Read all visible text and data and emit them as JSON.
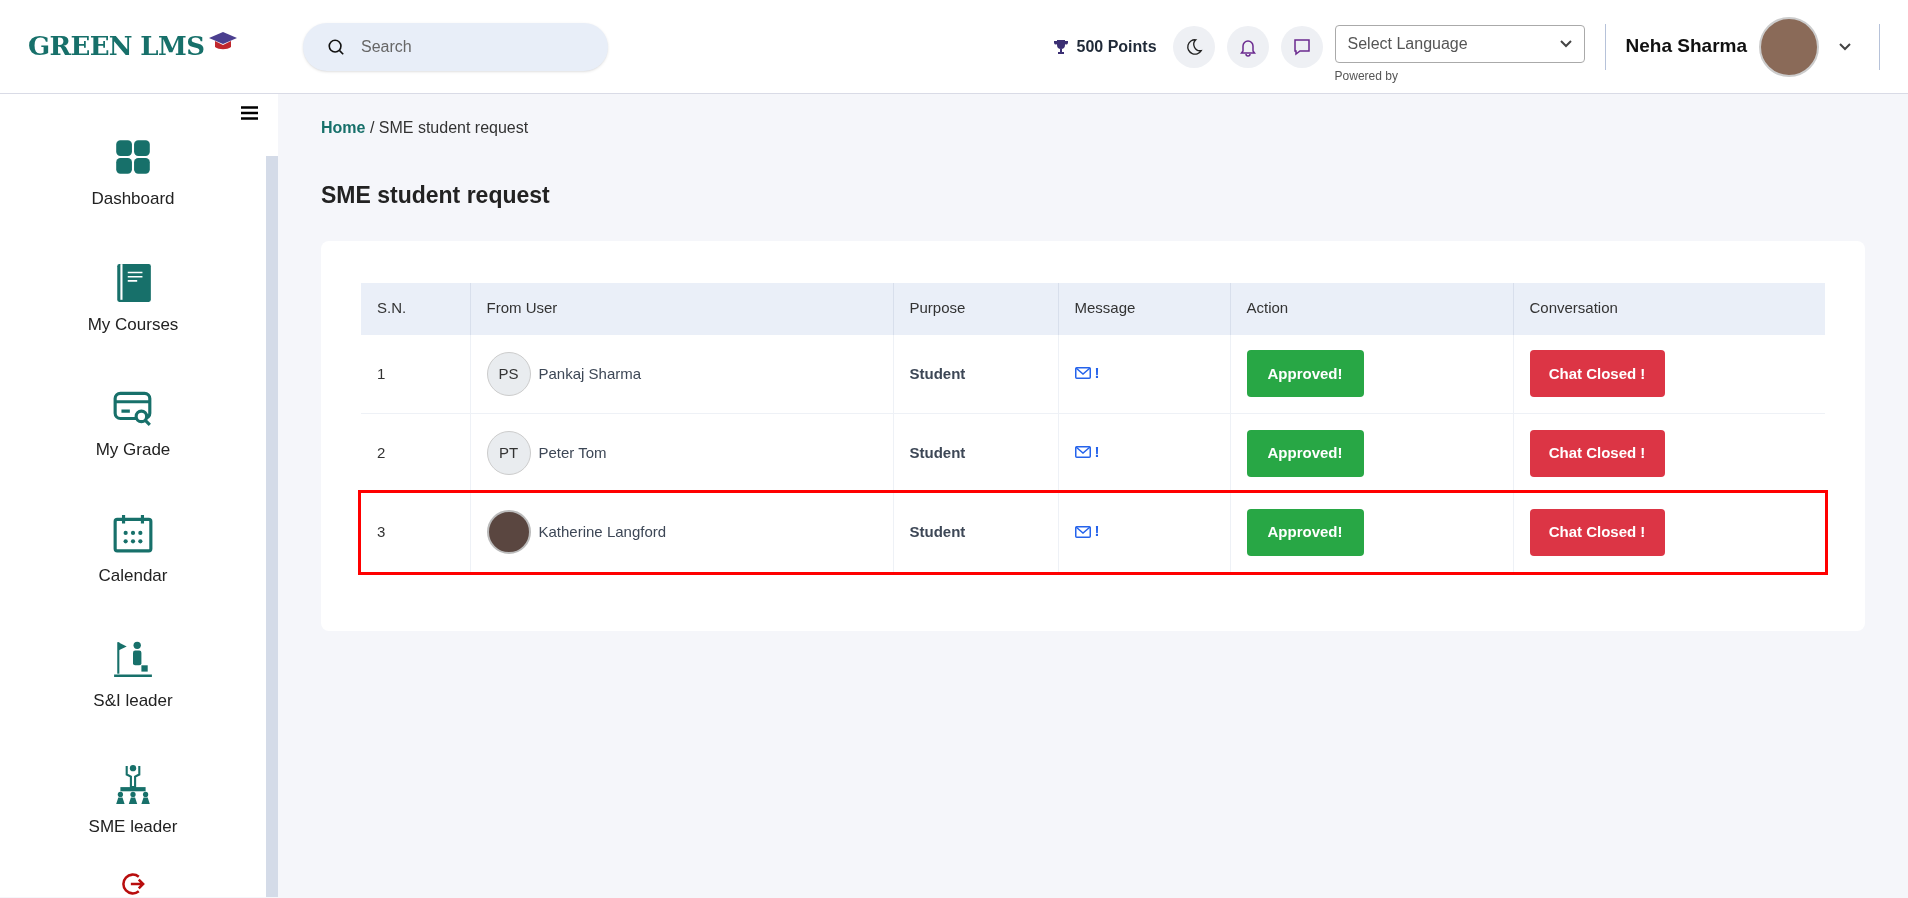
{
  "header": {
    "logo": "GREEN LMS",
    "search": {
      "placeholder": "Search"
    },
    "points": "500 Points",
    "language_select": {
      "value": "Select Language"
    },
    "powered_by": "Powered by",
    "user_name": "Neha Sharma"
  },
  "sidebar": {
    "items": [
      {
        "label": "Dashboard"
      },
      {
        "label": "My Courses"
      },
      {
        "label": "My Grade"
      },
      {
        "label": "Calendar"
      },
      {
        "label": "S&I leader"
      },
      {
        "label": "SME leader"
      }
    ]
  },
  "breadcrumb": {
    "home": "Home",
    "current": "/ SME student request"
  },
  "page_title": "SME student request",
  "table": {
    "columns": [
      "S.N.",
      "From User",
      "Purpose",
      "Message",
      "Action",
      "Conversation"
    ],
    "rows": [
      {
        "sn": "1",
        "avatar": {
          "kind": "initials",
          "text": "PS"
        },
        "user": "Pankaj Sharma",
        "purpose": "Student",
        "message": "!",
        "action": "Approved!",
        "conversation": "Chat Closed !",
        "highlighted": false
      },
      {
        "sn": "2",
        "avatar": {
          "kind": "initials",
          "text": "PT"
        },
        "user": "Peter Tom",
        "purpose": "Student",
        "message": "!",
        "action": "Approved!",
        "conversation": "Chat Closed !",
        "highlighted": false
      },
      {
        "sn": "3",
        "avatar": {
          "kind": "photo"
        },
        "user": "Katherine Langford",
        "purpose": "Student",
        "message": "!",
        "action": "Approved!",
        "conversation": "Chat Closed !",
        "highlighted": true
      }
    ]
  }
}
